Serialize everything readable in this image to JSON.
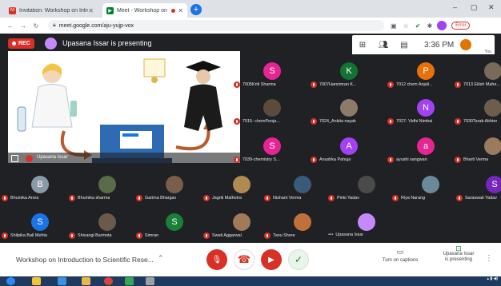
{
  "browser": {
    "tabs": [
      {
        "title": "Invitation: Workshop on Introd..."
      },
      {
        "title": "Meet - Workshop on Introdu..."
      }
    ],
    "url": "meet.google.com/aju-yujp-vox",
    "error_label": "Error"
  },
  "meeting": {
    "rec_label": "REC",
    "presenter_text": "Upasana Issar is presenting",
    "time": "3:36 PM",
    "you_label": "You",
    "slide_owner": "Upasana Issar"
  },
  "participants": [
    {
      "name": "7005Kriti Sharma",
      "initial": "S",
      "color": "#e52592"
    },
    {
      "name": "7007Harsimran K...",
      "initial": "K",
      "color": "#137333"
    },
    {
      "name": "7012 chem Anjali...",
      "initial": "P",
      "color": "#e8710a"
    },
    {
      "name": "7013 Eilish Mahe...",
      "initial": "",
      "color": "#7a6a5a"
    },
    {
      "name": "7015- chemPooja...",
      "initial": "",
      "color": "#5c4a3a"
    },
    {
      "name": "7024_Ankita nayak",
      "initial": "",
      "color": "#8d7a68"
    },
    {
      "name": "7027- Vidhi Nimbal",
      "initial": "N",
      "color": "#a142f4"
    },
    {
      "name": "7030Tarab Akhter",
      "initial": "",
      "color": "#6d5d4d"
    },
    {
      "name": "7039-chemistry S...",
      "initial": "S",
      "color": "#e52592"
    },
    {
      "name": "Anushka Pahuja",
      "initial": "A",
      "color": "#a142f4"
    },
    {
      "name": "ayushi sangwan",
      "initial": "a",
      "color": "#e52592"
    },
    {
      "name": "Bharti Verma",
      "initial": "",
      "color": "#9a7b60"
    },
    {
      "name": "Bhumika Arora",
      "initial": "B",
      "color": "#8a9ba8"
    },
    {
      "name": "Bhumika sharma",
      "initial": "",
      "color": "#5a6b4a"
    },
    {
      "name": "Garima Bhargav",
      "initial": "",
      "color": "#7b5e4a"
    },
    {
      "name": "Jagriti Malhotra",
      "initial": "",
      "color": "#b08a50"
    },
    {
      "name": "Nishant Verma",
      "initial": "",
      "color": "#3a5a7a"
    },
    {
      "name": "Pinki Yadav",
      "initial": "",
      "color": "#4a4a4a"
    },
    {
      "name": "Riya Narang",
      "initial": "",
      "color": "#6a8a9a"
    },
    {
      "name": "Saraswati Yadav",
      "initial": "S",
      "color": "#7627bb"
    },
    {
      "name": "Shilpika Bali Mehta",
      "initial": "S",
      "color": "#1a73e8"
    },
    {
      "name": "Shivangi Barmota",
      "initial": "",
      "color": "#6a5a4a"
    },
    {
      "name": "Simran",
      "initial": "S",
      "color": "#188038"
    },
    {
      "name": "Swati Aggarwal",
      "initial": "",
      "color": "#a07a5a"
    },
    {
      "name": "Tanu Shree",
      "initial": "",
      "color": "#c0703a"
    },
    {
      "name": "Upasana Issar",
      "initial": "",
      "color": "#c58af9"
    }
  ],
  "controls": {
    "meeting_title": "Workshop on Introduction to Scientific Rese...",
    "captions_label": "Turn on captions",
    "present_label_1": "Upasana Issar",
    "present_label_2": "is presenting"
  },
  "colors": {
    "accent_red": "#d93025",
    "meet_bg": "#202124",
    "accent_green": "#188038",
    "tab_strip": "#dee1e6",
    "taskbar": "#1f3a5f"
  },
  "icons": [
    "gmail-icon",
    "meet-icon",
    "close-icon",
    "new-tab-icon",
    "back-icon",
    "forward-icon",
    "reload-icon",
    "lock-icon",
    "grid-icon",
    "people-icon",
    "chat-icon",
    "mic-off-icon",
    "hang-up-icon",
    "camera-off-icon",
    "raise-hand-icon",
    "captions-icon",
    "present-icon",
    "more-icon"
  ]
}
